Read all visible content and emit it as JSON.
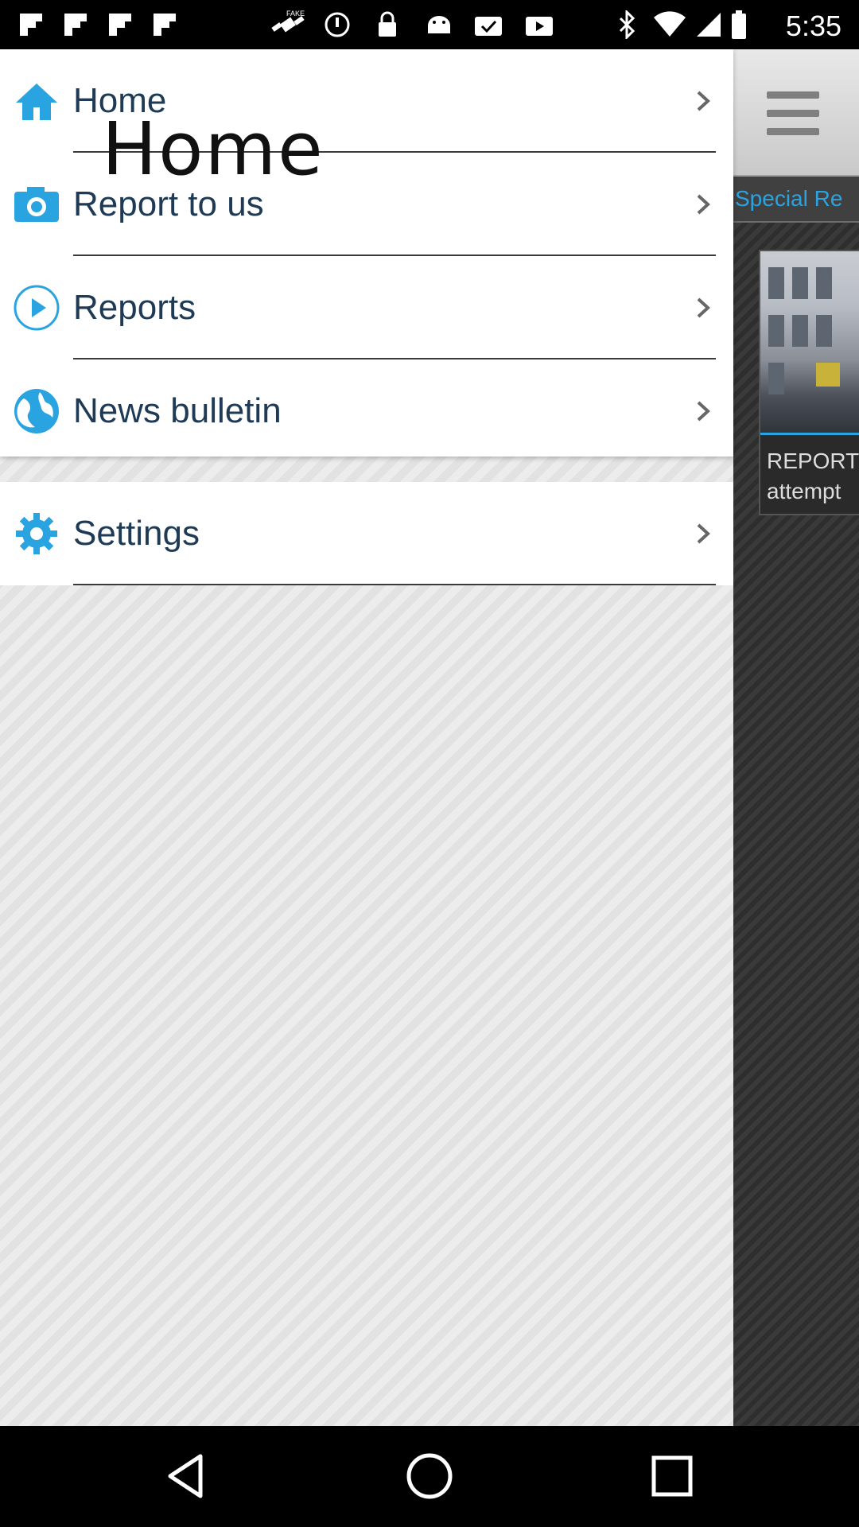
{
  "status_bar": {
    "time": "5:35",
    "icons": [
      "flipboard-icon",
      "flipboard-icon",
      "flipboard-icon",
      "flipboard-icon",
      "fake-gps-icon",
      "alarm-icon",
      "lock-icon",
      "android-icon",
      "task-check-icon",
      "video-icon",
      "bluetooth-icon",
      "wifi-icon",
      "signal-icon",
      "battery-icon"
    ]
  },
  "drawer": {
    "items": [
      {
        "label": "Home",
        "icon": "home-icon"
      },
      {
        "label": "Report to us",
        "icon": "camera-icon"
      },
      {
        "label": "Reports",
        "icon": "play-icon"
      },
      {
        "label": "News bulletin",
        "icon": "globe-icon"
      },
      {
        "label": "Settings",
        "icon": "gear-icon"
      }
    ],
    "overlay_text": "Home"
  },
  "background_app": {
    "special_label": "Special Re",
    "news_line1": "REPORT",
    "news_line2": "attempt"
  },
  "colors": {
    "accent": "#2aa4e0",
    "label": "#1e3a55"
  }
}
